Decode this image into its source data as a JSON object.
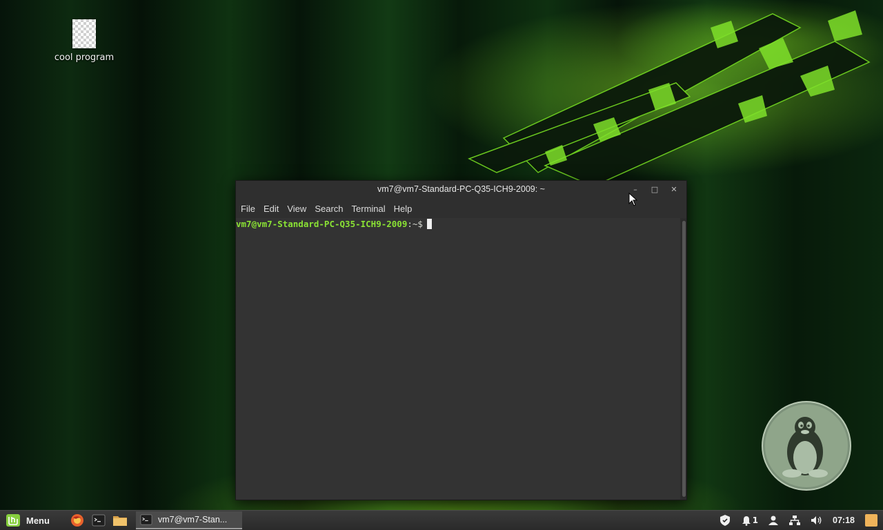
{
  "desktop": {
    "icons": [
      {
        "label": "cool program",
        "icon": "transparent-file-icon"
      }
    ]
  },
  "window": {
    "title": "vm7@vm7-Standard-PC-Q35-ICH9-2009: ~",
    "controls": {
      "minimize": "–",
      "maximize": "□",
      "close": "✕"
    },
    "menu": [
      "File",
      "Edit",
      "View",
      "Search",
      "Terminal",
      "Help"
    ],
    "terminal": {
      "user_host": "vm7@vm7-Standard-PC-Q35-ICH9-2009",
      "separator": ":",
      "path": "~",
      "symbol": "$"
    }
  },
  "taskbar": {
    "menu_label": "Menu",
    "launchers": [
      "firefox-icon",
      "terminal-icon",
      "files-icon"
    ],
    "task_label": "vm7@vm7-Stan...",
    "tray": {
      "notifications_count": "1",
      "clock": "07:18"
    }
  },
  "colors": {
    "prompt_green": "#8ae234",
    "terminal_bg": "#333333",
    "mint_green": "#87cf3e"
  }
}
